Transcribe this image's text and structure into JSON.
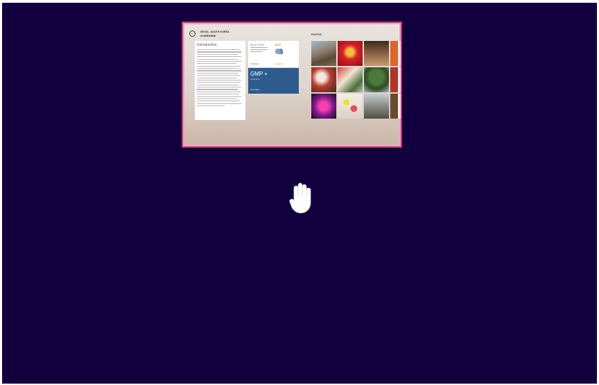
{
  "app": {
    "header_line1": "SEOUL, SOUTH KOREA",
    "header_line2": "OVERVIEW",
    "intro_heading": "Introduction",
    "weather": {
      "summary": "31.4°/ 19.3°",
      "temp": "84°F",
      "link_left": "Forecast",
      "link_right": "Weather"
    },
    "timezone": {
      "label": "GMP +",
      "sub": "Local time",
      "footer": "Get maps"
    },
    "photos_label": "PHOTOS"
  },
  "cursor": {
    "icon": "open-hand-cursor-icon"
  },
  "colors": {
    "background": "#11003d",
    "thumb_border": "#c9316f",
    "tile_blue": "#2d5b8e"
  }
}
